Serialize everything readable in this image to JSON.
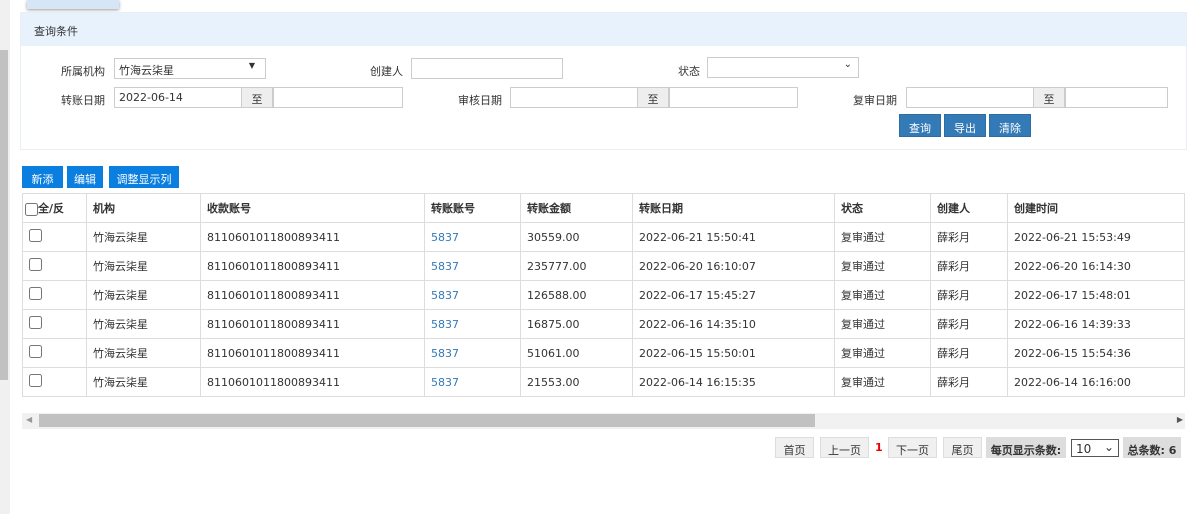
{
  "query": {
    "title": "查询条件",
    "org_label": "所属机构",
    "org_value": "竹海云柒星",
    "creator_label": "创建人",
    "creator_value": "",
    "status_label": "状态",
    "status_value": "",
    "transfer_date_label": "转账日期",
    "transfer_date_from": "2022-06-14",
    "to": "至",
    "review_date_label": "审核日期",
    "recheck_date_label": "复审日期",
    "search": "查询",
    "export": "导出",
    "clear": "清除"
  },
  "toolbar": {
    "add": "新添",
    "edit": "编辑",
    "columns": "调整显示列"
  },
  "table": {
    "headers": [
      "全/反",
      "机构",
      "收款账号",
      "转账账号",
      "转账金额",
      "转账日期",
      "状态",
      "创建人",
      "创建时间"
    ],
    "rows": [
      [
        "竹海云柒星",
        "8110601011800893411",
        "5837",
        "30559.00",
        "2022-06-21 15:50:41",
        "复审通过",
        "薛彩月",
        "2022-06-21 15:53:49"
      ],
      [
        "竹海云柒星",
        "8110601011800893411",
        "5837",
        "235777.00",
        "2022-06-20 16:10:07",
        "复审通过",
        "薛彩月",
        "2022-06-20 16:14:30"
      ],
      [
        "竹海云柒星",
        "8110601011800893411",
        "5837",
        "126588.00",
        "2022-06-17 15:45:27",
        "复审通过",
        "薛彩月",
        "2022-06-17 15:48:01"
      ],
      [
        "竹海云柒星",
        "8110601011800893411",
        "5837",
        "16875.00",
        "2022-06-16 14:35:10",
        "复审通过",
        "薛彩月",
        "2022-06-16 14:39:33"
      ],
      [
        "竹海云柒星",
        "8110601011800893411",
        "5837",
        "51061.00",
        "2022-06-15 15:50:01",
        "复审通过",
        "薛彩月",
        "2022-06-15 15:54:36"
      ],
      [
        "竹海云柒星",
        "8110601011800893411",
        "5837",
        "21553.00",
        "2022-06-14 16:15:35",
        "复审通过",
        "薛彩月",
        "2022-06-14 16:16:00"
      ]
    ]
  },
  "pager": {
    "first": "首页",
    "prev": "上一页",
    "current": "1",
    "next": "下一页",
    "last": "尾页",
    "per_page_label": "每页显示条数:",
    "per_page": "10",
    "total": "总条数: 6"
  }
}
